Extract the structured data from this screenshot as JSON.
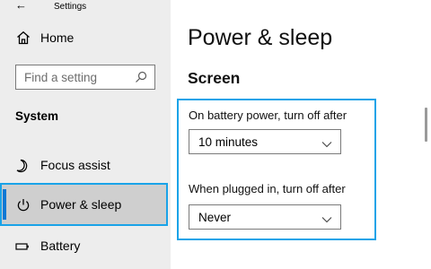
{
  "window": {
    "title": "Settings",
    "back_symbol": "←"
  },
  "sidebar": {
    "home": {
      "label": "Home",
      "icon": "home-icon"
    },
    "search": {
      "placeholder": "Find a setting",
      "icon": "search-icon"
    },
    "section_label": "System",
    "items": [
      {
        "label": "Focus assist",
        "icon": "moon-icon",
        "selected": false
      },
      {
        "label": "Power & sleep",
        "icon": "power-icon",
        "selected": true
      },
      {
        "label": "Battery",
        "icon": "battery-icon",
        "selected": false
      }
    ]
  },
  "main": {
    "page_title": "Power & sleep",
    "screen_group": {
      "title": "Screen",
      "battery": {
        "label": "On battery power, turn off after",
        "value": "10 minutes"
      },
      "plugged": {
        "label": "When plugged in, turn off after",
        "value": "Never"
      }
    }
  },
  "colors": {
    "accent": "#0a78d4",
    "highlight": "#1aa3e8",
    "sidebar_bg": "#ededed",
    "selected_bg": "#cfcfcf"
  }
}
